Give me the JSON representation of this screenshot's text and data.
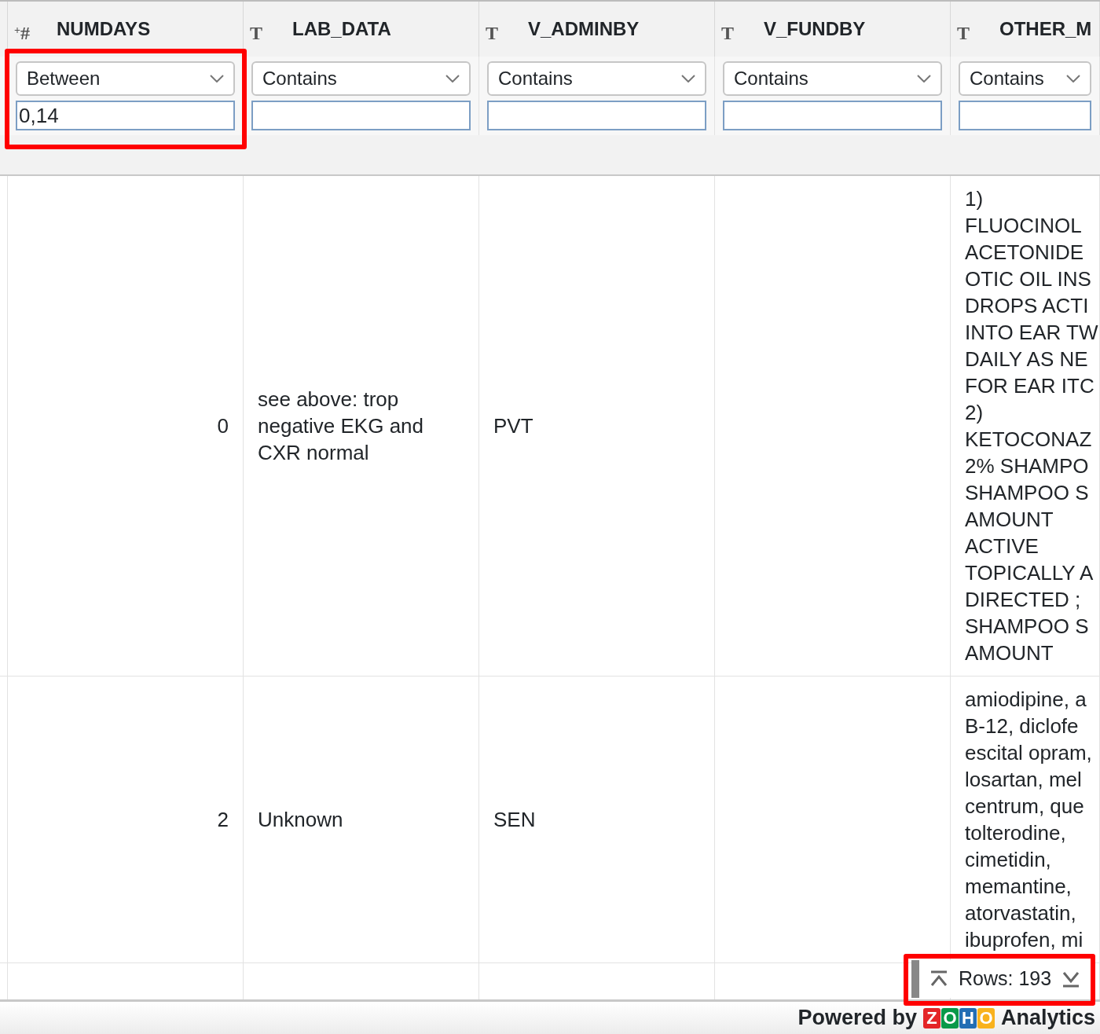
{
  "columns": [
    {
      "type_glyph": "$^{+}$#",
      "kind": "number",
      "label": "NUMDAYS",
      "filter_operator": "Between",
      "filter_value": "0,14",
      "highlighted": true
    },
    {
      "type_glyph": "T",
      "kind": "text",
      "label": "LAB_DATA",
      "filter_operator": "Contains",
      "highlighted": false
    },
    {
      "type_glyph": "T",
      "kind": "text",
      "label": "V_ADMINBY",
      "filter_operator": "Contains",
      "highlighted": false
    },
    {
      "type_glyph": "T",
      "kind": "text",
      "label": "V_FUNDBY",
      "filter_operator": "Contains",
      "highlighted": false
    },
    {
      "type_glyph": "T",
      "kind": "text",
      "label": "OTHER_M",
      "filter_operator": "Contains",
      "highlighted": false
    }
  ],
  "rows": [
    {
      "cells": [
        [
          "0"
        ],
        [
          "see above: trop negative EKG and CXR normal"
        ],
        [
          "PVT"
        ],
        [],
        [
          "1)",
          "FLUOCINOL",
          "ACETONIDE",
          "OTIC OIL INS",
          "DROPS  ACTI",
          "INTO EAR TW",
          "DAILY AS NE",
          "FOR EAR ITC",
          "2)",
          "KETOCONAZ",
          "2% SHAMPO",
          "SHAMPOO S",
          "AMOUNT",
          "ACTIVE",
          "TOPICALLY A",
          "DIRECTED ;",
          "SHAMPOO S",
          "AMOUNT"
        ]
      ]
    },
    {
      "cells": [
        [
          "2"
        ],
        [
          "Unknown"
        ],
        [
          "SEN"
        ],
        [],
        [
          "amiodipine, a",
          "B-12, diclofe",
          "escital opram,",
          "losartan, mel",
          "centrum, que",
          "tolterodine,",
          "cimetidin,",
          "memantine,",
          "atorvastatin,",
          "ibuprofen, mi"
        ]
      ]
    },
    {
      "cells": [
        [],
        [],
        [],
        [],
        []
      ]
    }
  ],
  "rows_counter": {
    "label": "Rows: 193",
    "highlighted": true
  },
  "footer": {
    "prefix": "Powered by",
    "logo_letters": [
      {
        "letter": "Z",
        "color": "#e42527"
      },
      {
        "letter": "O",
        "color": "#089949"
      },
      {
        "letter": "H",
        "color": "#226db4"
      },
      {
        "letter": "O",
        "color": "#f9b21d"
      }
    ],
    "product": "Analytics"
  }
}
